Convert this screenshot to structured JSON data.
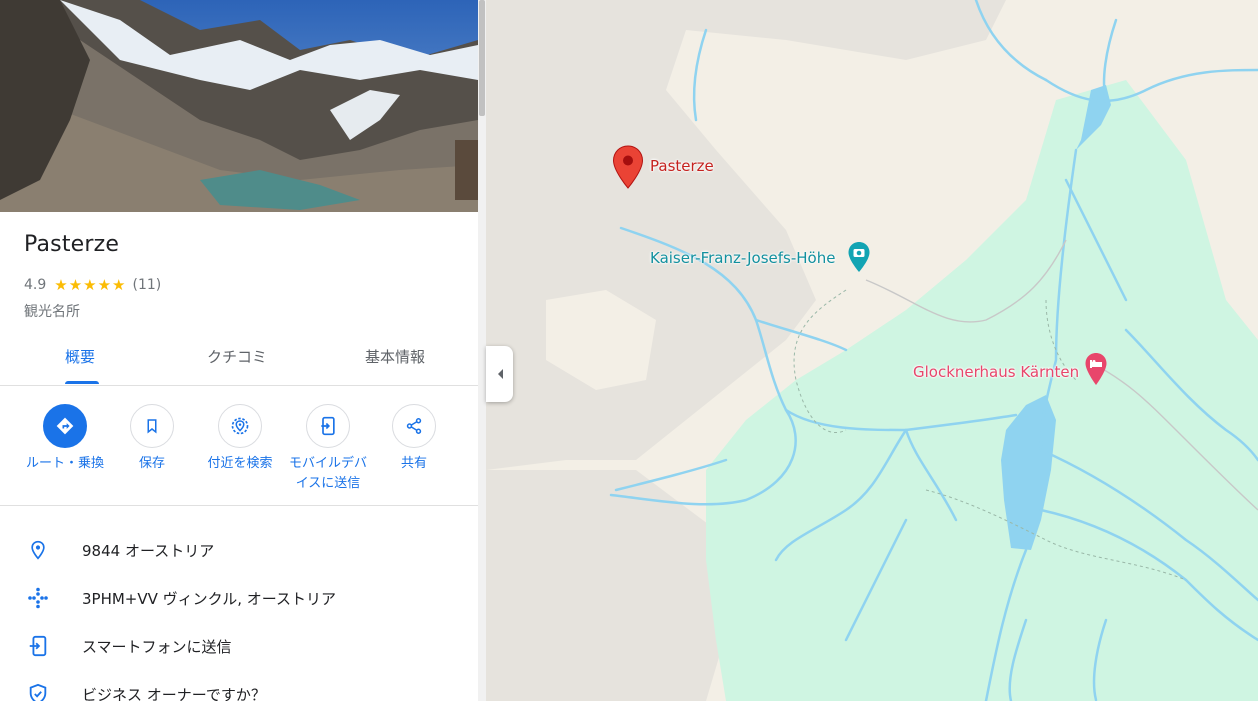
{
  "place": {
    "title": "Pasterze",
    "rating": "4.9",
    "stars": "★★★★★",
    "review_count": "(11)",
    "category": "観光名所"
  },
  "tabs": [
    {
      "label": "概要",
      "active": true
    },
    {
      "label": "クチコミ",
      "active": false
    },
    {
      "label": "基本情報",
      "active": false
    }
  ],
  "actions": [
    {
      "label": "ルート・乗換",
      "icon": "directions-icon"
    },
    {
      "label": "保存",
      "icon": "bookmark-icon"
    },
    {
      "label": "付近を検索",
      "icon": "nearby-search-icon"
    },
    {
      "label_line1": "モバイルデバ",
      "label_line2": "イスに送信",
      "icon": "send-to-phone-icon"
    },
    {
      "label": "共有",
      "icon": "share-icon"
    }
  ],
  "info": [
    {
      "text": "9844 オーストリア",
      "icon": "location-pin-icon"
    },
    {
      "text": "3PHM+VV ヴィンクル, オーストリア",
      "icon": "plus-code-icon"
    },
    {
      "text": "スマートフォンに送信",
      "icon": "send-to-phone-icon"
    },
    {
      "text": "ビジネス オーナーですか？",
      "icon": "verified-shield-icon"
    }
  ],
  "map": {
    "labels": {
      "pasterze": "Pasterze",
      "kaiser": "Kaiser-Franz-Josefs-Höhe",
      "glocknerhaus": "Glocknerhaus Kärnten"
    },
    "colors": {
      "accent": "#1a73e8",
      "park": "#cff5e2",
      "water": "#8fd3f0",
      "land": "#f3efe6",
      "pin": "#ea4335",
      "teal_poi": "#12a4b3",
      "pink_poi": "#e8466b"
    }
  }
}
